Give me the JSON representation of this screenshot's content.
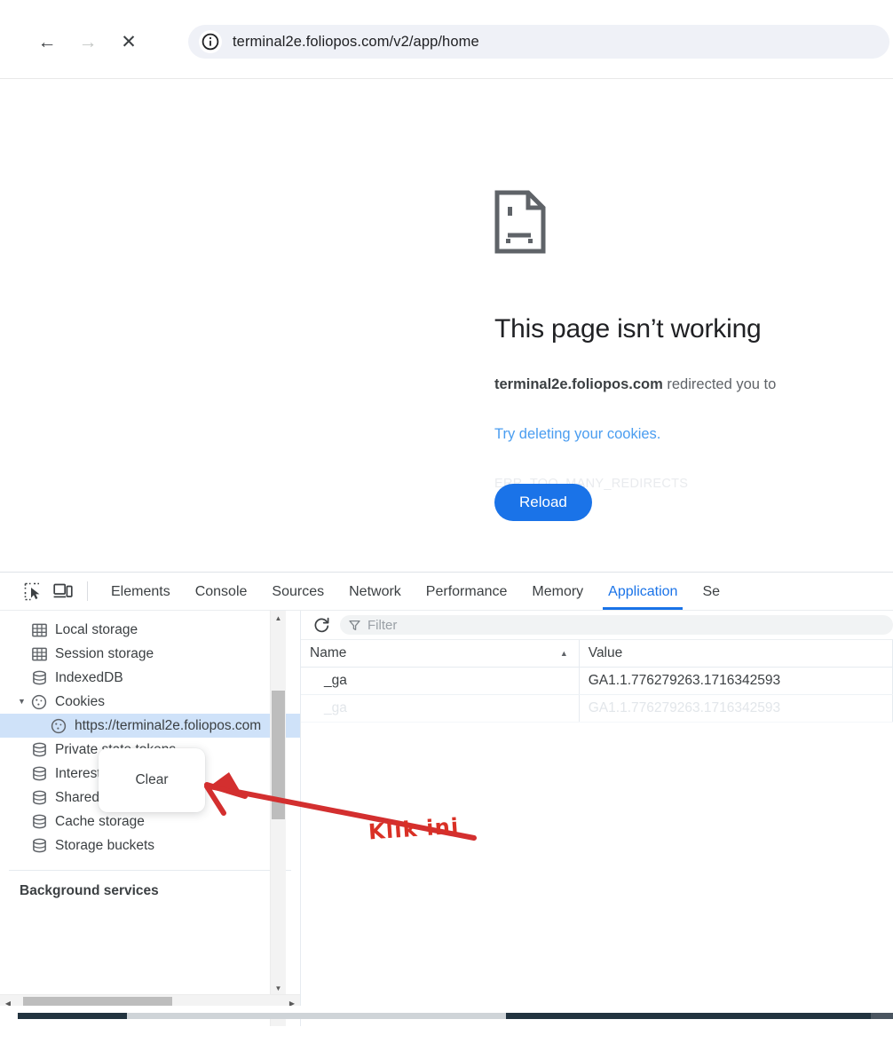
{
  "browser": {
    "back_icon": "arrow-left-icon",
    "forward_icon": "arrow-right-icon",
    "stop_icon": "close-icon",
    "site_info_icon": "info-circle-icon",
    "url": "terminal2e.foliopos.com/v2/app/home"
  },
  "error_page": {
    "icon": "sad-document-icon",
    "title": "This page isn’t working",
    "description_host": "terminal2e.foliopos.com",
    "description_rest": " redirected you to",
    "link": "Try deleting your cookies.",
    "error_code": "ERR_TOO_MANY_REDIRECTS",
    "reload_label": "Reload"
  },
  "devtools": {
    "inspect_icon": "inspect-element-icon",
    "device_toolbar_icon": "device-toolbar-icon",
    "tabs": [
      {
        "label": "Elements",
        "active": false
      },
      {
        "label": "Console",
        "active": false
      },
      {
        "label": "Sources",
        "active": false
      },
      {
        "label": "Network",
        "active": false
      },
      {
        "label": "Performance",
        "active": false
      },
      {
        "label": "Memory",
        "active": false
      },
      {
        "label": "Application",
        "active": true
      },
      {
        "label": "Se",
        "active": false
      }
    ],
    "sidebar": {
      "items": [
        {
          "label": "Local storage",
          "icon": "table-icon",
          "indent": 0,
          "selected": false,
          "expanded": null
        },
        {
          "label": "Session storage",
          "icon": "table-icon",
          "indent": 0,
          "selected": false,
          "expanded": null
        },
        {
          "label": "IndexedDB",
          "icon": "database-icon",
          "indent": 0,
          "selected": false,
          "expanded": null
        },
        {
          "label": "Cookies",
          "icon": "cookie-icon",
          "indent": 0,
          "selected": false,
          "expanded": true
        },
        {
          "label": "https://terminal2e.foliopos.com",
          "icon": "cookie-icon",
          "indent": 1,
          "selected": true,
          "expanded": null
        },
        {
          "label": "Private state tokens",
          "icon": "database-icon",
          "indent": 0,
          "selected": false,
          "expanded": null
        },
        {
          "label": "Interest groups",
          "icon": "database-icon",
          "indent": 0,
          "selected": false,
          "expanded": null
        },
        {
          "label": "Shared storage",
          "icon": "database-icon",
          "indent": 0,
          "selected": false,
          "expanded": null
        },
        {
          "label": "Cache storage",
          "icon": "database-icon",
          "indent": 0,
          "selected": false,
          "expanded": null
        },
        {
          "label": "Storage buckets",
          "icon": "database-icon",
          "indent": 0,
          "selected": false,
          "expanded": null
        }
      ],
      "section_title": "Background services",
      "scrollbar_up_icon": "triangle-up-icon",
      "scrollbar_down_icon": "triangle-down-icon",
      "scrollbar_left_icon": "triangle-left-icon",
      "scrollbar_right_icon": "triangle-right-icon"
    },
    "toolbar": {
      "refresh_icon": "refresh-icon",
      "filter_icon": "funnel-icon",
      "filter_placeholder": "Filter"
    },
    "cookie_table": {
      "columns": [
        {
          "label": "Name",
          "sorted": "asc",
          "sort_icon": "triangle-up-icon"
        },
        {
          "label": "Value",
          "sorted": null,
          "sort_icon": ""
        }
      ],
      "rows": [
        {
          "name": "_ga",
          "value": "GA1.1.776279263.1716342593",
          "faded": false
        },
        {
          "name": "_ga",
          "value": "GA1.1.776279263.1716342593",
          "faded": true
        }
      ]
    },
    "context_menu": {
      "items": [
        {
          "label": "Clear"
        }
      ]
    }
  },
  "annotation": {
    "text": "Klik ini",
    "color": "#d93025",
    "arrow_icon": "arrow-pointer-icon"
  },
  "colors": {
    "accent": "#1a73e8",
    "selection": "#cfe2f9",
    "link": "#4a9df0",
    "annotation": "#d93025"
  }
}
